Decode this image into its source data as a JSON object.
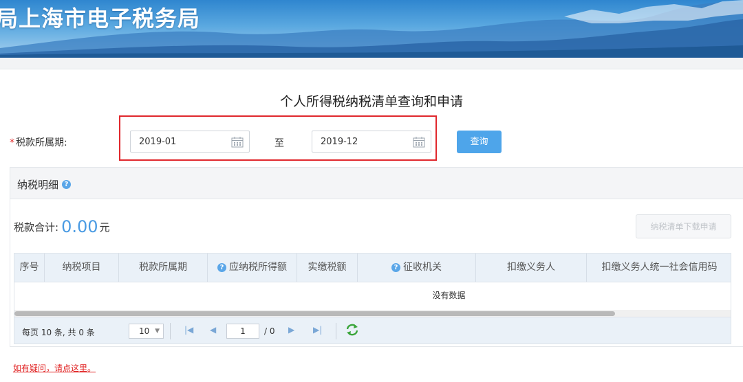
{
  "banner": {
    "title": "局上海市电子税务局"
  },
  "page": {
    "title": "个人所得税纳税清单查询和申请"
  },
  "filter": {
    "required_mark": "*",
    "period_label": "税款所属期:",
    "start_value": "2019-01",
    "to_label": "至",
    "end_value": "2019-12",
    "query_label": "查询"
  },
  "detail": {
    "title": "纳税明细",
    "total_label": "税款合计:",
    "total_amount": "0.00",
    "total_unit": "元",
    "download_label": "纳税清单下载申请"
  },
  "table": {
    "columns": [
      "序号",
      "纳税项目",
      "税款所属期",
      "应纳税所得额",
      "实缴税额",
      "征收机关",
      "扣缴义务人",
      "扣缴义务人统一社会信用码"
    ],
    "empty_text": "没有数据"
  },
  "pager": {
    "info": "每页 10 条, 共 0 条",
    "page_size": "10",
    "current_page": "1",
    "total_pages": "/ 0"
  },
  "footer": {
    "help_link": "如有疑问，请点这里。"
  },
  "colors": {
    "accent": "#4ea5ea",
    "highlight": "#e0272c",
    "link": "#e02020"
  }
}
